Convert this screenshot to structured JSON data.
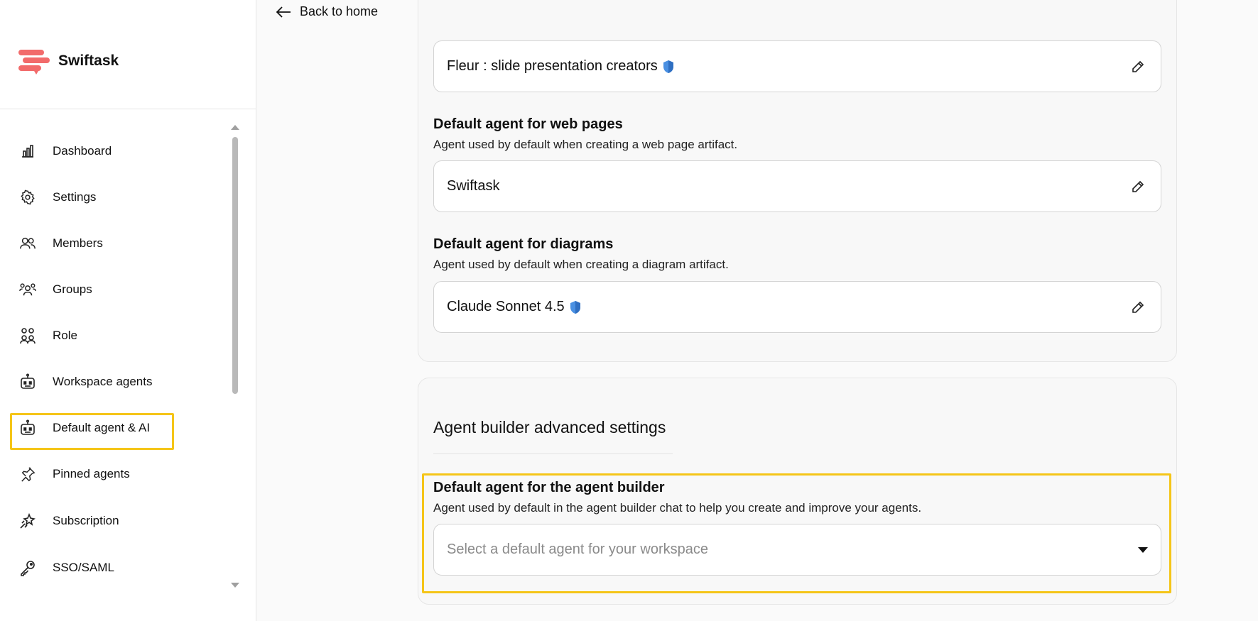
{
  "brand": {
    "name": "Swiftask",
    "color": "#f26b6b"
  },
  "back_link": {
    "label": "Back to home"
  },
  "sidebar": {
    "items": [
      {
        "label": "Dashboard",
        "icon": "bar-chart-icon"
      },
      {
        "label": "Settings",
        "icon": "gear-icon"
      },
      {
        "label": "Members",
        "icon": "users-icon"
      },
      {
        "label": "Groups",
        "icon": "group-icon"
      },
      {
        "label": "Role",
        "icon": "role-icon"
      },
      {
        "label": "Workspace agents",
        "icon": "robot-icon"
      },
      {
        "label": "Default agent & AI",
        "icon": "robot-icon",
        "highlighted": true
      },
      {
        "label": "Pinned agents",
        "icon": "pin-icon"
      },
      {
        "label": "Subscription",
        "icon": "sparkle-icon"
      },
      {
        "label": "SSO/SAML",
        "icon": "key-icon"
      }
    ]
  },
  "main": {
    "slides_field": {
      "value": "Fleur  : slide presentation creators",
      "badge": "shield-badge-icon"
    },
    "web_pages": {
      "title": "Default agent for web pages",
      "description": "Agent used by default when creating a web page artifact.",
      "value": "Swiftask"
    },
    "diagrams": {
      "title": "Default agent for diagrams",
      "description": "Agent used by default when creating a diagram artifact.",
      "value": "Claude Sonnet 4.5",
      "badge": "shield-badge-icon"
    },
    "agent_builder": {
      "section_title": "Agent builder advanced settings",
      "title": "Default agent for the agent builder",
      "description": "Agent used by default in the agent builder chat to help you create and improve your agents.",
      "placeholder": "Select a default agent for your workspace"
    }
  },
  "colors": {
    "highlight": "#f5c518",
    "shield": "#4a90e2"
  }
}
